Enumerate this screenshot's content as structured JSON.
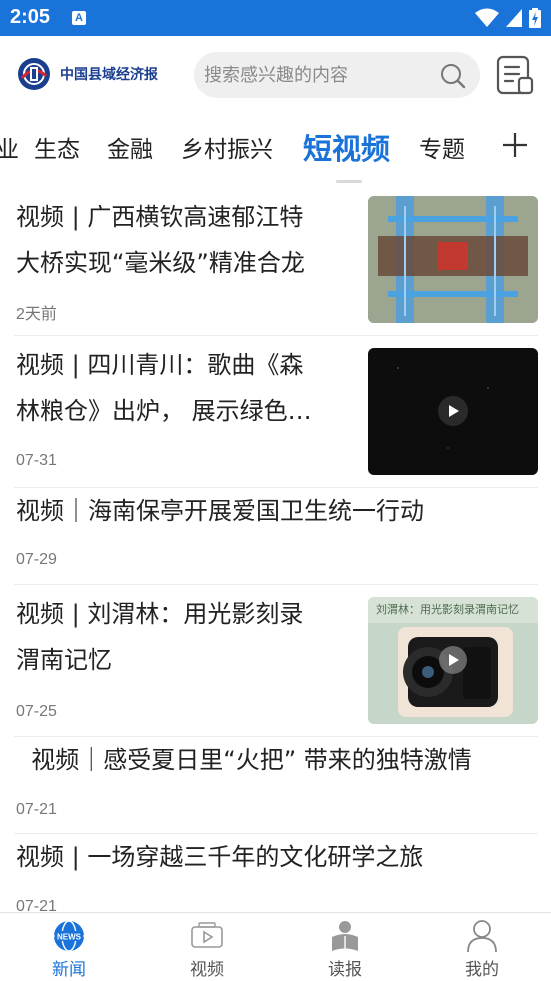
{
  "status_bar": {
    "time": "2:05",
    "app_icon_letter": "A",
    "icons": [
      "wifi-icon",
      "signal-icon",
      "battery-charging-icon"
    ]
  },
  "header": {
    "logo_text": "中国县域经济报",
    "search_placeholder": "搜索感兴趣的内容",
    "icons": [
      "search-icon",
      "newspaper-icon"
    ]
  },
  "tabs": {
    "items": [
      "业",
      "生态",
      "金融",
      "乡村振兴",
      "短视频",
      "专题"
    ],
    "active": "短视频",
    "add_icon": "plus-icon"
  },
  "news": [
    {
      "title_line1": "视频 | 广西横钦高速郁江特",
      "title_line2": "大桥实现“毫米级”精准合龙",
      "date": "2天前",
      "thumb": "bridge-aerial"
    },
    {
      "title_line1": "视频 | 四川青川：歌曲《森",
      "title_line2": "林粮仓》出炉， 展示绿色…",
      "date": "07-31",
      "thumb": "dark-video-play"
    },
    {
      "title_line1": "视频｜海南保亭开展爱国卫生统一行动",
      "title_line2": "",
      "date": "07-29",
      "thumb": ""
    },
    {
      "title_line1": "视频 | 刘渭林：用光影刻录",
      "title_line2": "渭南记忆",
      "date": "07-25",
      "thumb": "camera-hands",
      "thumb_caption": "刘渭林：用光影刻录渭南记忆"
    },
    {
      "title_line1": "  视频｜感受夏日里“火把” 带来的独特激情",
      "title_line2": "",
      "date": "07-21",
      "thumb": ""
    },
    {
      "title_line1": "视频 | 一场穿越三千年的文化研学之旅",
      "title_line2": "",
      "date": "07-21",
      "thumb": ""
    }
  ],
  "bottom_nav": {
    "items": [
      {
        "label": "新闻",
        "icon": "news-globe-icon",
        "icon_text": "NEWS"
      },
      {
        "label": "视频",
        "icon": "video-icon"
      },
      {
        "label": "读报",
        "icon": "reader-icon"
      },
      {
        "label": "我的",
        "icon": "profile-icon"
      }
    ],
    "active": "新闻"
  },
  "colors": {
    "accent": "#1a73d9",
    "brand_dark": "#1b3f8f",
    "brand_red": "#d9232d",
    "text": "#222222",
    "muted": "#777777"
  }
}
